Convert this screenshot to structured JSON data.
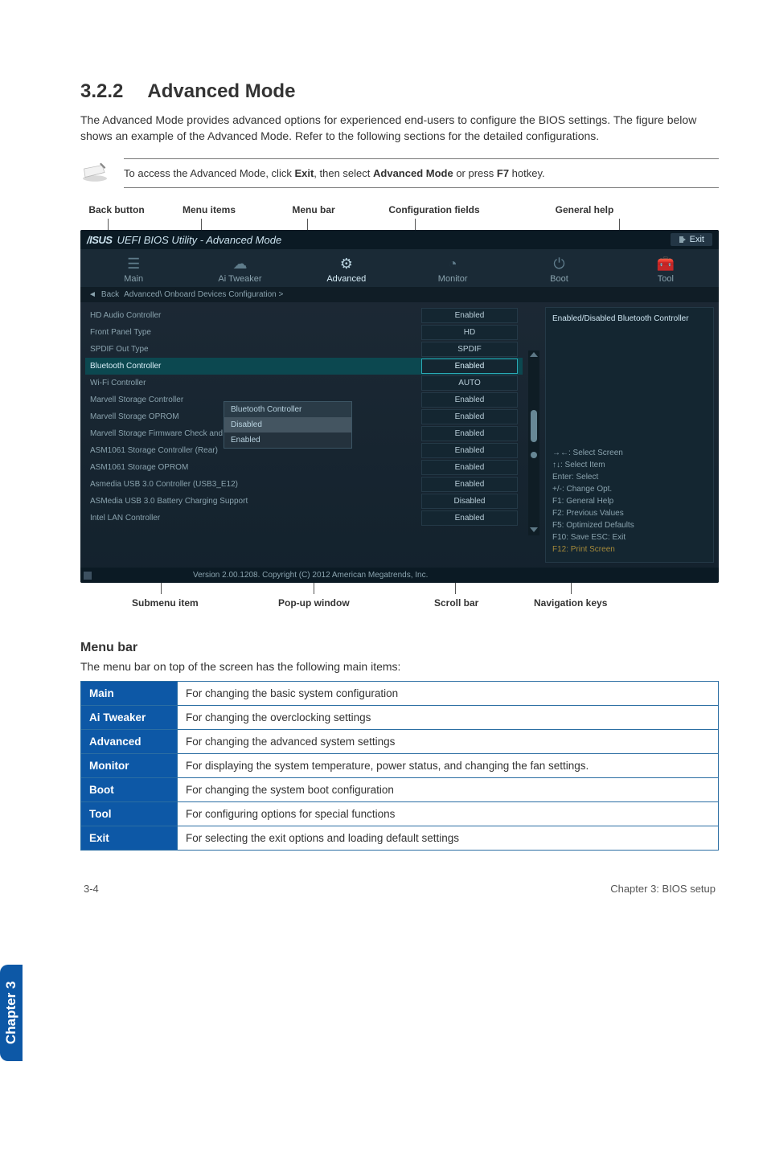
{
  "heading_num": "3.2.2",
  "heading_title": "Advanced Mode",
  "intro": "The Advanced Mode provides advanced options for experienced end-users to configure the BIOS settings. The figure below shows an example of the Advanced Mode. Refer to the following sections for the detailed configurations.",
  "note_prefix": "To access the Advanced Mode, click ",
  "note_bold1": "Exit",
  "note_mid": ", then select ",
  "note_bold2": "Advanced Mode",
  "note_suffix": " or press ",
  "note_bold3": "F7",
  "note_end": " hotkey.",
  "top_labels": {
    "back": "Back button",
    "items": "Menu items",
    "bar": "Menu bar",
    "conf": "Configuration fields",
    "help": "General help"
  },
  "bios": {
    "brand": "/ISUS",
    "title": "UEFI BIOS Utility - Advanced Mode",
    "exit": "Exit",
    "tabs": {
      "main": "Main",
      "tweaker": "Ai Tweaker",
      "advanced": "Advanced",
      "monitor": "Monitor",
      "boot": "Boot",
      "tool": "Tool"
    },
    "crumb_back": "Back",
    "crumb_path": "Advanced\\ Onboard Devices Configuration  >",
    "settings": [
      {
        "label": "HD Audio Controller",
        "value": "Enabled",
        "sel": false
      },
      {
        "label": "Front Panel Type",
        "value": "HD",
        "sel": false
      },
      {
        "label": "SPDIF Out Type",
        "value": "SPDIF",
        "sel": false
      },
      {
        "label": "Bluetooth Controller",
        "value": "Enabled",
        "sel": true
      },
      {
        "label": "Wi-Fi Controller",
        "value": "AUTO",
        "sel": false
      },
      {
        "label": "Marvell Storage Controller",
        "value": "Enabled",
        "sel": false
      },
      {
        "label": "Marvell Storage OPROM",
        "value": "Enabled",
        "sel": false
      },
      {
        "label": "Marvell Storage Firmware Check and Update",
        "value": "Enabled",
        "sel": false
      },
      {
        "label": "ASM1061 Storage Controller (Rear)",
        "value": "Enabled",
        "sel": false
      },
      {
        "label": "ASM1061 Storage OPROM",
        "value": "Enabled",
        "sel": false
      },
      {
        "label": "Asmedia USB 3.0 Controller (USB3_E12)",
        "value": "Enabled",
        "sel": false
      },
      {
        "label": "ASMedia USB 3.0 Battery Charging Support",
        "value": "Disabled",
        "sel": false
      },
      {
        "label": "Intel LAN Controller",
        "value": "Enabled",
        "sel": false
      }
    ],
    "popup": {
      "head": "Bluetooth Controller",
      "opt1": "Disabled",
      "opt2": "Enabled"
    },
    "help_text": "Enabled/Disabled Bluetooth Controller",
    "keys": [
      "→←: Select Screen",
      "↑↓: Select Item",
      "Enter: Select",
      "+/-: Change Opt.",
      "F1: General Help",
      "F2: Previous Values",
      "F5: Optimized Defaults",
      "F10: Save   ESC: Exit",
      "F12: Print Screen"
    ],
    "version": "Version 2.00.1208.  Copyright (C) 2012 American Megatrends, Inc."
  },
  "bot_labels": {
    "sub": "Submenu item",
    "pop": "Pop-up window",
    "scroll": "Scroll bar",
    "nav": "Navigation keys"
  },
  "menubar_heading": "Menu bar",
  "menubar_intro": "The menu bar on top of the screen has the following main items:",
  "menutable": [
    {
      "k": "Main",
      "v": "For changing the basic system configuration"
    },
    {
      "k": "Ai Tweaker",
      "v": "For changing the overclocking settings"
    },
    {
      "k": "Advanced",
      "v": "For changing the advanced system settings"
    },
    {
      "k": "Monitor",
      "v": "For displaying the system temperature, power status, and changing the fan settings."
    },
    {
      "k": "Boot",
      "v": "For changing the system boot configuration"
    },
    {
      "k": "Tool",
      "v": "For configuring options for special functions"
    },
    {
      "k": "Exit",
      "v": "For selecting the exit options and loading default settings"
    }
  ],
  "sidetab": "Chapter 3",
  "footer_left": "3-4",
  "footer_right": "Chapter 3: BIOS setup"
}
